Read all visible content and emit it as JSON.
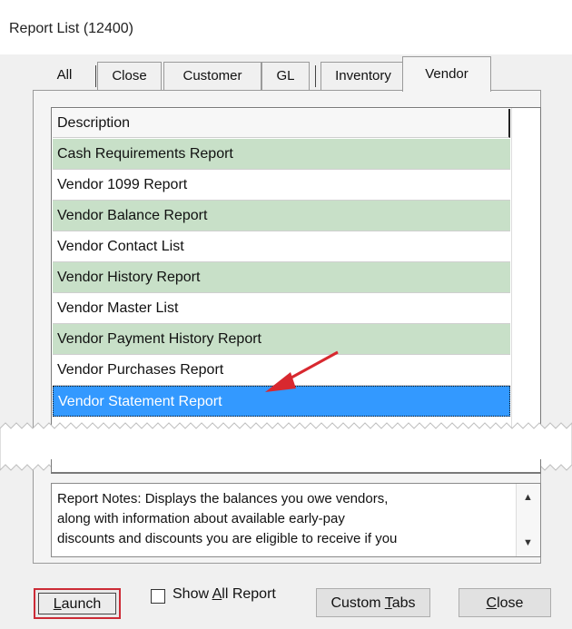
{
  "window": {
    "title": "Report List (12400)"
  },
  "tabs": [
    {
      "label": "All",
      "active": false
    },
    {
      "label": "Close",
      "active": false
    },
    {
      "label": "Customer",
      "active": false
    },
    {
      "label": "GL",
      "active": false
    },
    {
      "label": "Inventory",
      "active": false
    },
    {
      "label": "Vendor",
      "active": true
    }
  ],
  "list": {
    "column_header": "Description",
    "rows": [
      {
        "label": "Cash Requirements Report",
        "style": "green"
      },
      {
        "label": "Vendor 1099 Report",
        "style": "white"
      },
      {
        "label": "Vendor Balance Report",
        "style": "green"
      },
      {
        "label": "Vendor Contact List",
        "style": "white"
      },
      {
        "label": "Vendor History Report",
        "style": "green"
      },
      {
        "label": "Vendor Master List",
        "style": "white"
      },
      {
        "label": "Vendor Payment History Report",
        "style": "green"
      },
      {
        "label": "Vendor Purchases Report",
        "style": "white"
      },
      {
        "label": "Vendor Statement Report",
        "style": "selected"
      }
    ]
  },
  "notes": {
    "text": "Report Notes:  Displays the balances you owe vendors,\nalong with information about available early-pay\ndiscounts and discounts you are eligible to receive if you"
  },
  "buttons": {
    "launch": {
      "prefix": "",
      "underline": "L",
      "rest": "aunch"
    },
    "custom_tabs": {
      "prefix": "Custom ",
      "underline": "T",
      "rest": "abs"
    },
    "close": {
      "prefix": "",
      "underline": "C",
      "rest": "lose"
    }
  },
  "show_all": {
    "prefix": "Show ",
    "underline": "A",
    "rest": "ll Report",
    "checked": false
  },
  "colors": {
    "selected_row": "#3399ff",
    "alt_row": "#c8e0c8",
    "highlight_box": "#cc2b36",
    "annotation_arrow": "#d8282f"
  }
}
